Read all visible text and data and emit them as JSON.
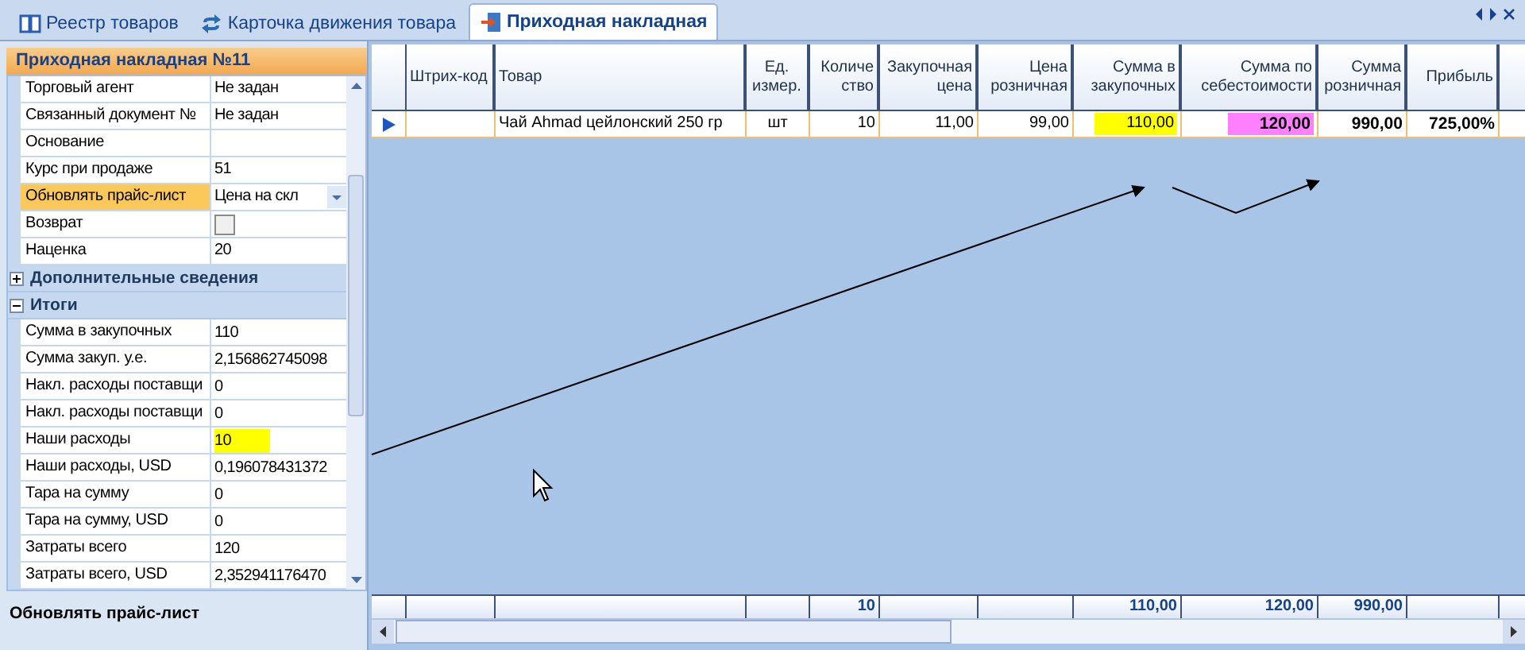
{
  "tabs": [
    {
      "label": "Реестр товаров",
      "selected": false
    },
    {
      "label": "Карточка движения товара",
      "selected": false
    },
    {
      "label": "Приходная накладная",
      "selected": true
    }
  ],
  "properties": {
    "title": "Приходная накладная №11",
    "rows": [
      {
        "label": "Торговый агент",
        "value": "Не задан",
        "kind": "text",
        "selected": false
      },
      {
        "label": "Связанный документ №",
        "value": "Не задан",
        "kind": "text",
        "selected": false
      },
      {
        "label": "Основание",
        "kind": "text",
        "selected": false
      },
      {
        "label": "Курс при продаже",
        "value": "51",
        "kind": "text",
        "selected": false
      },
      {
        "label": "Обновлять прайс-лист",
        "value": "Цена на скл",
        "kind": "dropdown",
        "selected": true
      },
      {
        "label": "Возврат",
        "kind": "checkbox",
        "checked": false,
        "selected": false
      },
      {
        "label": "Наценка",
        "value": "20",
        "kind": "text",
        "selected": false
      }
    ],
    "categories": [
      {
        "label": "Дополнительные сведения",
        "expanded": false
      },
      {
        "label": "Итоги",
        "expanded": true,
        "rows": [
          {
            "label": "Сумма в закупочных",
            "value": "110"
          },
          {
            "label": "Сумма закуп. у.е.",
            "value": "2,156862745098"
          },
          {
            "label": "Накл. расходы поставщи",
            "value": "0"
          },
          {
            "label": "Накл. расходы поставщи",
            "value": "0"
          },
          {
            "label": "Наши расходы",
            "value": "10",
            "color": "#ffff00"
          },
          {
            "label": "Наши расходы, USD",
            "value": "0,196078431372"
          },
          {
            "label": "Тара на сумму",
            "value": "0"
          },
          {
            "label": "Тара на сумму, USD",
            "value": "0"
          },
          {
            "label": "Затраты всего",
            "value": "120"
          },
          {
            "label": "Затраты всего, USD",
            "value": "2,352941176470"
          }
        ]
      }
    ],
    "description": "Обновлять прайс-лист"
  },
  "table": {
    "columns": [
      {
        "label": "Штрих-код"
      },
      {
        "label": "Товар"
      },
      {
        "label": "Ед. измер."
      },
      {
        "label": "Количе ство",
        "total": "10"
      },
      {
        "label": "Закупочная цена"
      },
      {
        "label": "Цена розничная"
      },
      {
        "label": "Сумма в закупочных",
        "total": "110,00"
      },
      {
        "label": "Сумма по себестоимости",
        "total": "120,00"
      },
      {
        "label": "Сумма розничная",
        "total": "990,00"
      },
      {
        "label": "Прибыль"
      }
    ],
    "rows": [
      {
        "selected": true,
        "cells": [
          {},
          {
            "text": "Чай Ahmad цейлонский 250 гр"
          },
          {
            "text": "шт"
          },
          {
            "text": "10"
          },
          {
            "text": "11,00"
          },
          {
            "text": "99,00"
          },
          {
            "text": "110,00",
            "color": "#ffff00"
          },
          {
            "text": "120,00",
            "color": "#ff80ff",
            "bold": true
          },
          {
            "text": "990,00",
            "bold": true
          },
          {
            "text": "725,00%",
            "bold": true
          }
        ]
      }
    ]
  }
}
